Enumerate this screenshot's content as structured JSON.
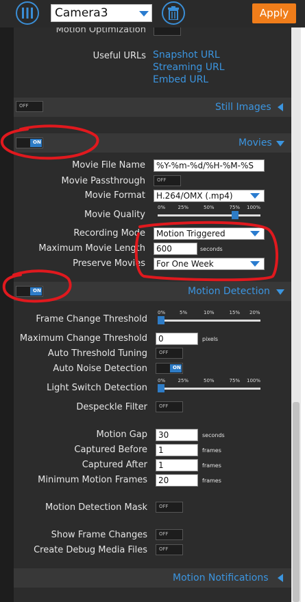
{
  "topbar": {
    "camera_select": "Camera3",
    "apply_label": "Apply"
  },
  "partial_row_label": "Motion Optimization",
  "useful_urls": {
    "label": "Useful URLs",
    "snapshot": "Snapshot URL",
    "streaming": "Streaming URL",
    "embed": "Embed URL"
  },
  "still_images": {
    "title": "Still Images",
    "toggle": "OFF"
  },
  "movies": {
    "title": "Movies",
    "toggle": "ON",
    "file_name": {
      "label": "Movie File Name",
      "value": "%Y-%m-%d/%H-%M-%S"
    },
    "passthrough": {
      "label": "Movie Passthrough",
      "toggle": "OFF"
    },
    "format": {
      "label": "Movie Format",
      "value": "H.264/OMX (.mp4)"
    },
    "quality": {
      "label": "Movie Quality",
      "ticks": [
        "0%",
        "25%",
        "50%",
        "75%",
        "100%"
      ],
      "value_percent": 75
    },
    "recording_mode": {
      "label": "Recording Mode",
      "value": "Motion Triggered"
    },
    "max_length": {
      "label": "Maximum Movie Length",
      "value": "600",
      "unit": "seconds"
    },
    "preserve": {
      "label": "Preserve Movies",
      "value": "For One Week"
    }
  },
  "motion_detection": {
    "title": "Motion Detection",
    "toggle": "ON",
    "frame_change_threshold": {
      "label": "Frame Change Threshold",
      "ticks": [
        "0%",
        "5%",
        "10%",
        "15%",
        "20%"
      ],
      "value_percent": 0
    },
    "max_change_threshold": {
      "label": "Maximum Change Threshold",
      "value": "0",
      "unit": "pixels"
    },
    "auto_threshold": {
      "label": "Auto Threshold Tuning",
      "toggle": "OFF"
    },
    "auto_noise": {
      "label": "Auto Noise Detection",
      "toggle": "ON"
    },
    "light_switch": {
      "label": "Light Switch Detection",
      "ticks": [
        "0%",
        "25%",
        "50%",
        "75%",
        "100%"
      ],
      "value_percent": 0
    },
    "despeckle": {
      "label": "Despeckle Filter",
      "toggle": "OFF"
    },
    "motion_gap": {
      "label": "Motion Gap",
      "value": "30",
      "unit": "seconds"
    },
    "captured_before": {
      "label": "Captured Before",
      "value": "1",
      "unit": "frames"
    },
    "captured_after": {
      "label": "Captured After",
      "value": "1",
      "unit": "frames"
    },
    "min_motion_frames": {
      "label": "Minimum Motion Frames",
      "value": "20",
      "unit": "frames"
    },
    "mask": {
      "label": "Motion Detection Mask",
      "toggle": "OFF"
    },
    "show_frame_changes": {
      "label": "Show Frame Changes",
      "toggle": "OFF"
    },
    "debug_media": {
      "label": "Create Debug Media Files",
      "toggle": "OFF"
    }
  },
  "motion_notifications": {
    "title": "Motion Notifications"
  },
  "colors": {
    "accent": "#3b95e0",
    "apply": "#f07d1a",
    "annotation": "#e0191e"
  }
}
